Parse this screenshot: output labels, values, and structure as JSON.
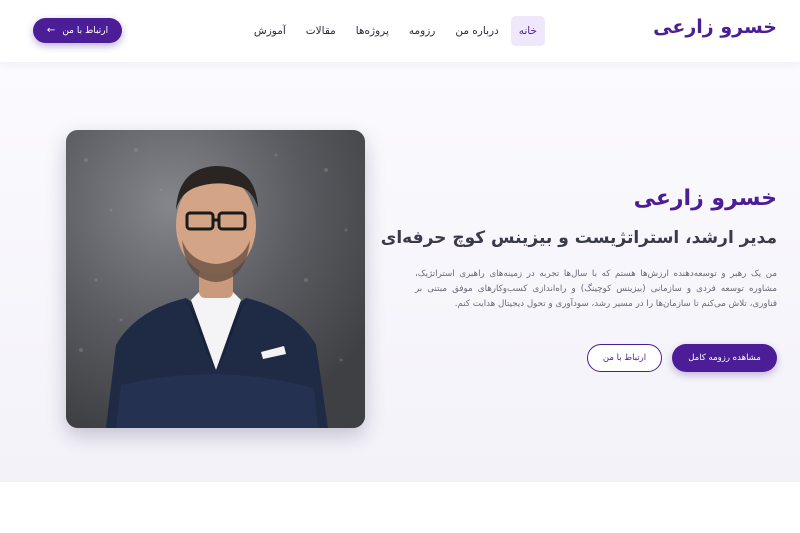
{
  "colors": {
    "accent": "#4b1d96",
    "accent_light": "#efe7fb"
  },
  "navbar": {
    "brand": "خسرو زارعی",
    "links": [
      {
        "label": "خانه",
        "active": true
      },
      {
        "label": "درباره من"
      },
      {
        "label": "رزومه"
      },
      {
        "label": "پروژه‌ها"
      },
      {
        "label": "مقالات"
      },
      {
        "label": "آموزش"
      }
    ],
    "cta_label": "ارتباط با من",
    "cta_icon": "arrow-left-icon"
  },
  "hero": {
    "name": "خسرو زارعی",
    "title": "مدیر ارشد، استراتژیست و بیزینس کوچ حرفه‌ای",
    "bio": "من یک رهبر و توسعه‌دهنده ارزش‌ها هستم که با سال‌ها تجربه در زمینه‌های راهبری استراتژیک، مشاوره توسعه فردی و سازمانی (بیزینس کوچینگ) و راه‌اندازی کسب‌وکارهای موفق مبتنی بر فناوری، تلاش می‌کنم تا سازمان‌ها را در مسیر رشد، سودآوری و تحول دیجیتال هدایت کنم.",
    "primary_button": "مشاهده رزومه کامل",
    "secondary_button": "ارتباط با من"
  }
}
